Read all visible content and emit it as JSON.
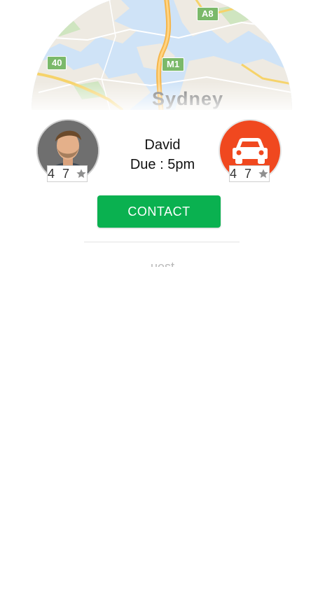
{
  "map": {
    "city_label": "Sydney",
    "road_badges": [
      "A8",
      "40",
      "M1"
    ]
  },
  "driver": {
    "name": "David",
    "due": "Due : 5pm",
    "rating": "4 7",
    "avatar_bg": "#6f6f6f"
  },
  "car": {
    "rating": "4 7",
    "icon": "car-icon",
    "color": "#f0481f"
  },
  "actions": {
    "contact_label": "CONTACT",
    "contact_color": "#0ab150"
  },
  "below": {
    "faded_text": "uest"
  }
}
